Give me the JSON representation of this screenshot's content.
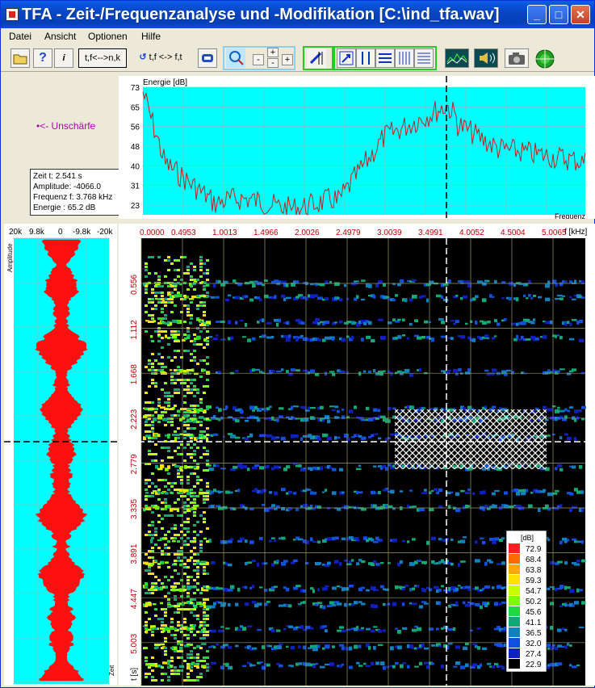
{
  "window": {
    "title": "TFA - Zeit-/Frequenzanalyse und -Modifikation [C:\\ind_tfa.wav]",
    "minimize_label": "_",
    "maximize_label": "□",
    "close_label": "✕"
  },
  "menu": [
    "Datei",
    "Ansicht",
    "Optionen",
    "Hilfe"
  ],
  "toolbar": {
    "transform_label": "t,f<-->n,k",
    "swap_label": "t,f <-> f,t",
    "zoom_minus": "-",
    "zoom_plus_a": "+",
    "zoom_plus_b": "+",
    "zoom_minus_b": "-"
  },
  "unschaerfe_label": "•<- Unschärfe",
  "info": {
    "lines": [
      "Zeit t:  2.541 s",
      "Amplitude: -4066.0",
      "Frequenz f:  3.768 kHz",
      "Energie : 65.2 dB"
    ]
  },
  "energy_plot": {
    "ylabel": "Energie [dB]",
    "xlabel": "Frequenz",
    "yticks": [
      "73",
      "65",
      "56",
      "48",
      "40",
      "31",
      "23"
    ]
  },
  "waveform": {
    "xticks": [
      "20k",
      "9.8k",
      "0",
      "-9.8k",
      "-20k"
    ],
    "ylabel": "Amplitude",
    "xlabel": "Zeit"
  },
  "spectrogram": {
    "freq_ticks": [
      "0.0000",
      "0.4953",
      "1.0013",
      "1.4966",
      "2.0026",
      "2.4979",
      "3.0039",
      "3.4991",
      "4.0052",
      "4.5004",
      "5.0065"
    ],
    "freq_unit": "f [kHz]",
    "time_ticks": [
      "0.556",
      "1.112",
      "1.668",
      "2.223",
      "2.779",
      "3.335",
      "3.891",
      "4.447",
      "5.003"
    ],
    "time_unit": "t [s]"
  },
  "colorbar": {
    "title": "[dB]",
    "levels": [
      {
        "value": "72.9",
        "color": "#ff2020"
      },
      {
        "value": "68.4",
        "color": "#ff6a00"
      },
      {
        "value": "63.8",
        "color": "#ffa800"
      },
      {
        "value": "59.3",
        "color": "#ffe000"
      },
      {
        "value": "54.7",
        "color": "#c8ff00"
      },
      {
        "value": "50.2",
        "color": "#7cff00"
      },
      {
        "value": "45.6",
        "color": "#20d840"
      },
      {
        "value": "41.1",
        "color": "#10a878"
      },
      {
        "value": "36.5",
        "color": "#1080c0"
      },
      {
        "value": "32.0",
        "color": "#1050e0"
      },
      {
        "value": "27.4",
        "color": "#1020c0"
      },
      {
        "value": "22.9",
        "color": "#000000"
      }
    ]
  }
}
